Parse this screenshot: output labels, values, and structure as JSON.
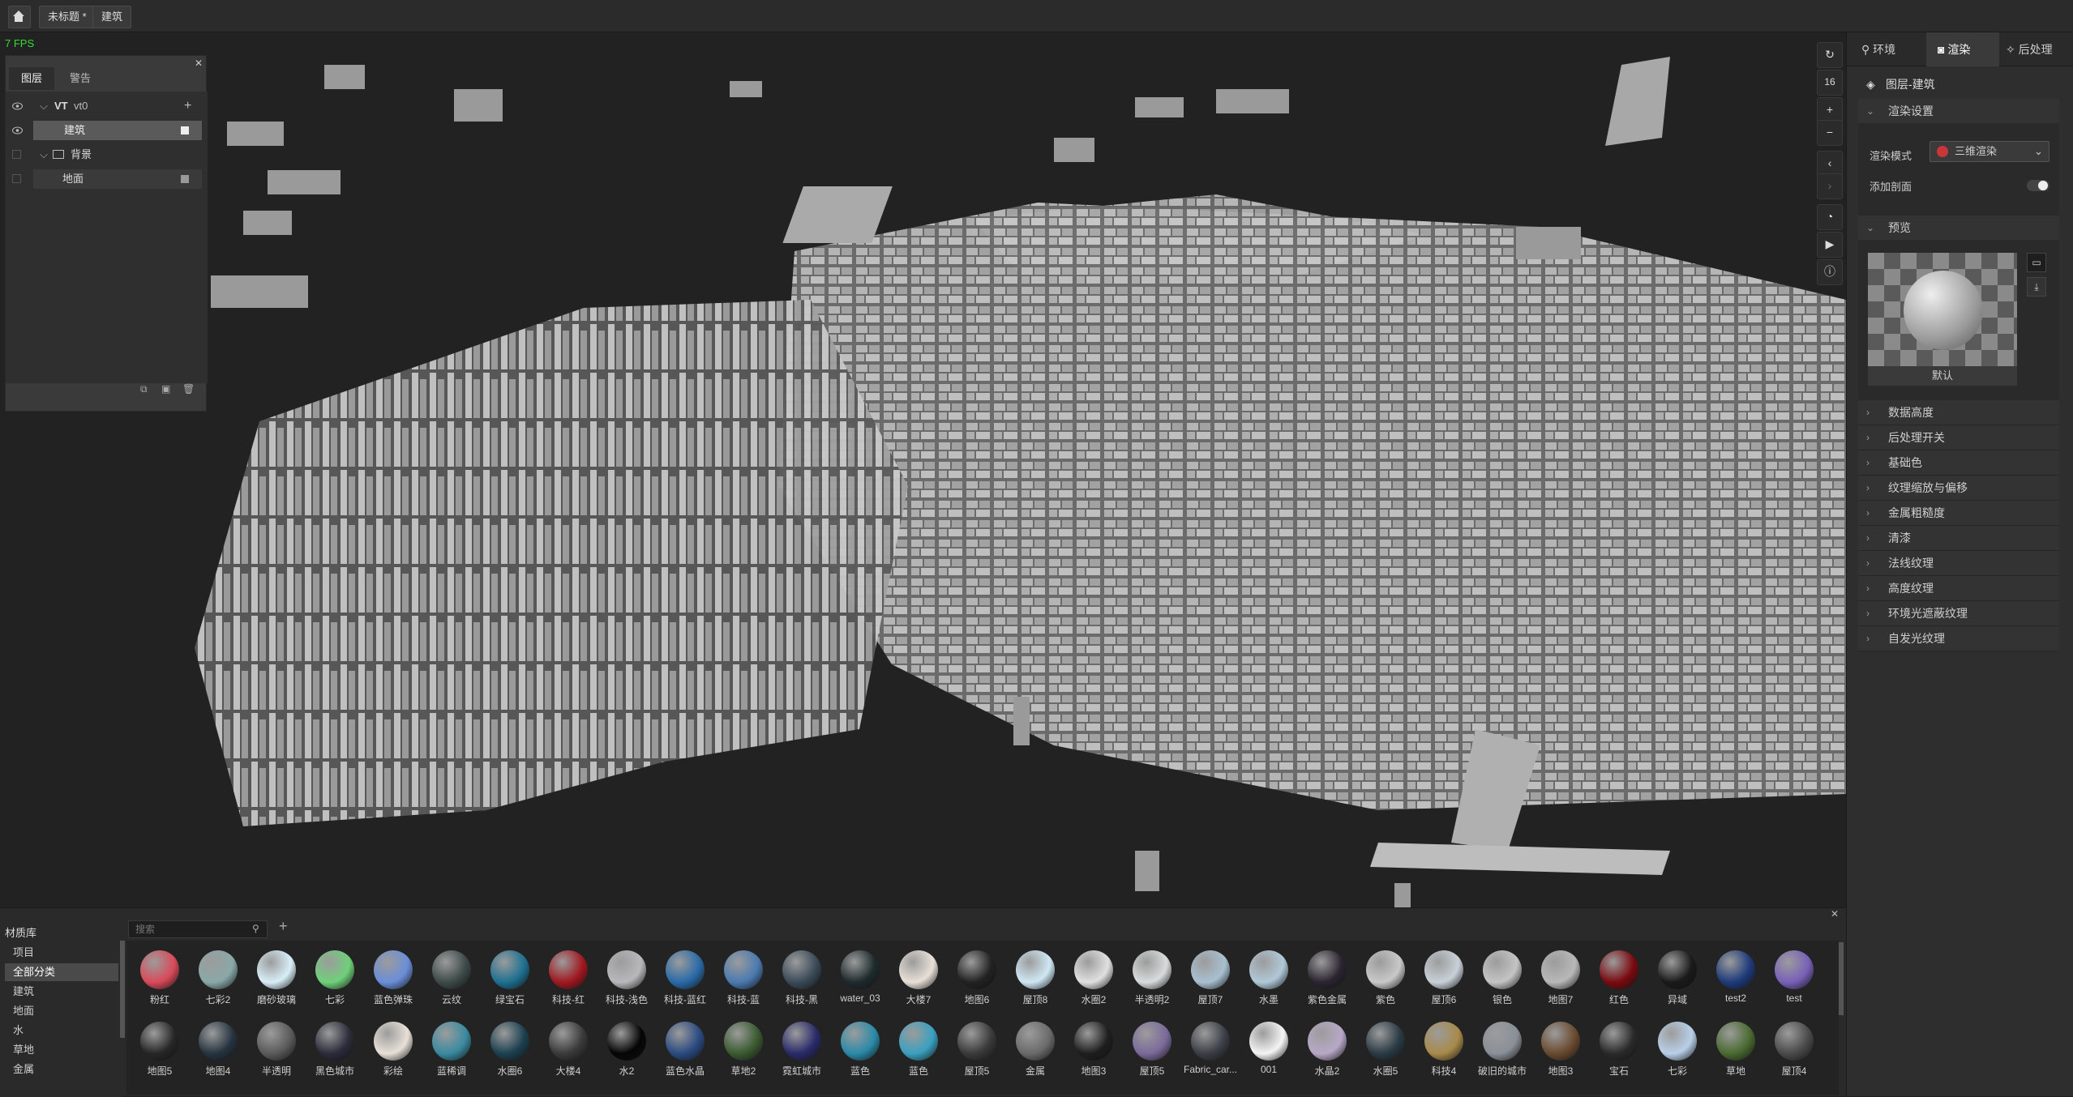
{
  "topbar": {
    "tab_untitled": "未标题 *",
    "tab_building": "建筑"
  },
  "fps": "7 FPS",
  "layers": {
    "tab_layers": "图层",
    "tab_warnings": "警告",
    "root_label": "VT",
    "root_sub": "vt0",
    "items": [
      {
        "label": "建筑"
      },
      {
        "label": "背景"
      },
      {
        "label": "地面"
      }
    ]
  },
  "viewport_toolbar": {
    "zoom_level": "16"
  },
  "right_panel": {
    "tabs": [
      "环境",
      "渲染",
      "后处理"
    ],
    "active_tab": "渲染",
    "layer_title": "图层-建筑",
    "render_settings": "渲染设置",
    "render_mode_label": "渲染模式",
    "render_mode_value": "三维渲染",
    "add_section_label": "添加剖面",
    "preview_title": "预览",
    "preview_caption": "默认",
    "sections": [
      "数据高度",
      "后处理开关",
      "基础色",
      "纹理缩放与偏移",
      "金属粗糙度",
      "清漆",
      "法线纹理",
      "高度纹理",
      "环境光遮蔽纹理",
      "自发光纹理"
    ]
  },
  "material_library": {
    "title": "材质库",
    "search_placeholder": "搜索",
    "categories": [
      "项目",
      "全部分类",
      "建筑",
      "地面",
      "水",
      "草地",
      "金属"
    ],
    "active_category": "全部分类",
    "row1": [
      {
        "label": "粉红",
        "color": "#d94a5a"
      },
      {
        "label": "七彩2",
        "color": "#8aa8a8"
      },
      {
        "label": "磨砂玻璃",
        "color": "#d8eef8"
      },
      {
        "label": "七彩",
        "color": "#6fd07a"
      },
      {
        "label": "蓝色弹珠",
        "color": "#6a8ed8"
      },
      {
        "label": "云纹",
        "color": "#3c4a48"
      },
      {
        "label": "绿宝石",
        "color": "#1e7090"
      },
      {
        "label": "科技-红",
        "color": "#a01820"
      },
      {
        "label": "科技-浅色",
        "color": "#b8b8bc"
      },
      {
        "label": "科技-蓝红",
        "color": "#2a6aa8"
      },
      {
        "label": "科技-蓝",
        "color": "#4a7ab0"
      },
      {
        "label": "科技-黑",
        "color": "#3a4a58"
      },
      {
        "label": "water_03",
        "color": "#1e2a2c"
      },
      {
        "label": "大楼7",
        "color": "#e8e0d8"
      },
      {
        "label": "地图6",
        "color": "#222"
      },
      {
        "label": "屋顶8",
        "color": "#cfe8f4"
      },
      {
        "label": "水圈2",
        "color": "#e0e0e0"
      },
      {
        "label": "半透明2",
        "color": "#d8dcdc"
      },
      {
        "label": "屋顶7",
        "color": "#a8c0d0"
      },
      {
        "label": "水墨",
        "color": "#b0c8d8"
      },
      {
        "label": "紫色金属",
        "color": "#2a2430"
      },
      {
        "label": "紫色",
        "color": "#c8c8c8"
      },
      {
        "label": "屋顶6",
        "color": "#c8d0d8"
      },
      {
        "label": "银色",
        "color": "#c4c4c4"
      },
      {
        "label": "地图7",
        "color": "#b8b8b8"
      },
      {
        "label": "红色",
        "color": "#7a0a10"
      },
      {
        "label": "异域",
        "color": "#1a1a1a"
      },
      {
        "label": "test2",
        "color": "#1e3a7a"
      },
      {
        "label": "test",
        "color": "#7860b8"
      }
    ],
    "row2": [
      {
        "label": "地图5",
        "color": "#262626"
      },
      {
        "label": "地图4",
        "color": "#263440"
      },
      {
        "label": "半透明",
        "color": "#5a5a5a"
      },
      {
        "label": "黑色城市",
        "color": "#2a2c3a"
      },
      {
        "label": "彩绘",
        "color": "#e8e0d8"
      },
      {
        "label": "蓝稀调",
        "color": "#3a8aa0"
      },
      {
        "label": "水圈6",
        "color": "#1c4050"
      },
      {
        "label": "大楼4",
        "color": "#3a3a3a"
      },
      {
        "label": "水2",
        "color": "#050505"
      },
      {
        "label": "蓝色水晶",
        "color": "#2a4a80"
      },
      {
        "label": "草地2",
        "color": "#3a5a30"
      },
      {
        "label": "霓虹城市",
        "color": "#2a2a6a"
      },
      {
        "label": "蓝色",
        "color": "#2a8aa8"
      },
      {
        "label": "蓝色",
        "color": "#3aa0c0"
      },
      {
        "label": "屋顶5",
        "color": "#3a3a3a"
      },
      {
        "label": "金属",
        "color": "#6a6a6a"
      },
      {
        "label": "地图3",
        "color": "#1e1e1e"
      },
      {
        "label": "屋顶5",
        "color": "#7a6a9a"
      },
      {
        "label": "Fabric_car...",
        "color": "#3a3e46"
      },
      {
        "label": "001",
        "color": "#f4f4f4"
      },
      {
        "label": "水晶2",
        "color": "#b8a8c8"
      },
      {
        "label": "水圈5",
        "color": "#2a3a44"
      },
      {
        "label": "科技4",
        "color": "#a88a4a"
      },
      {
        "label": "破旧的城市",
        "color": "#8a9098"
      },
      {
        "label": "地图3",
        "color": "#6a4a30"
      },
      {
        "label": "宝石",
        "color": "#2a2a2a"
      },
      {
        "label": "七彩",
        "color": "#b8d0e8"
      },
      {
        "label": "草地",
        "color": "#4a6a30"
      },
      {
        "label": "屋顶4",
        "color": "#4a4a4a"
      }
    ]
  }
}
